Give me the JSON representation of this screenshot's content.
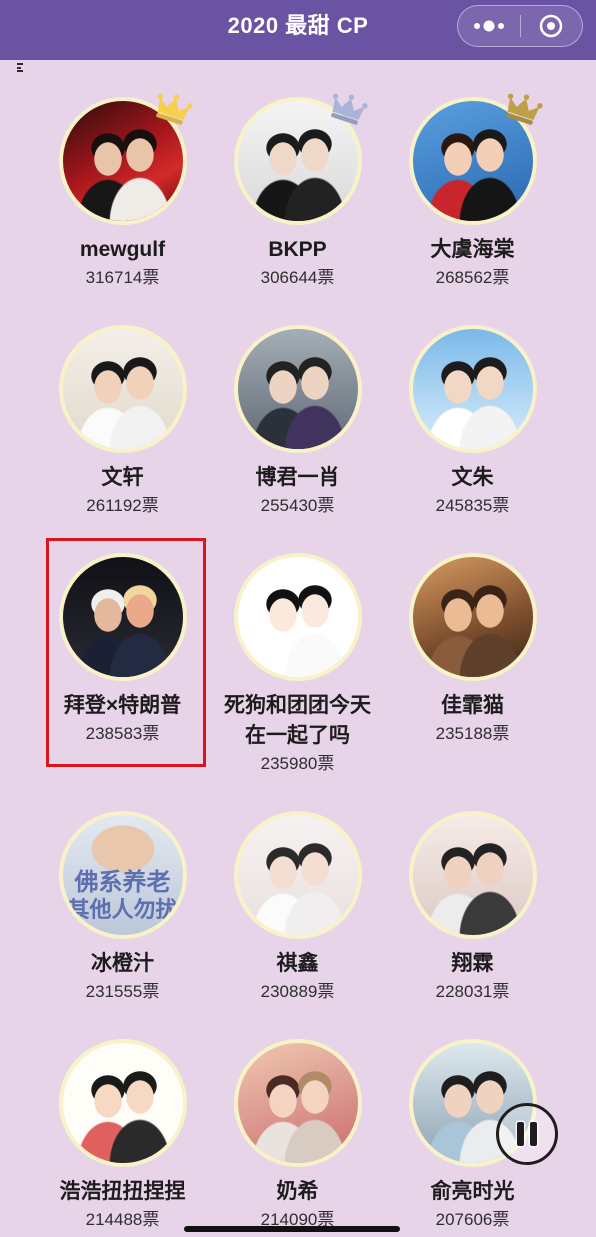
{
  "header": {
    "title": "2020 最甜 CP",
    "icons": {
      "more": "more-dots-icon",
      "exit": "target-circle-icon"
    }
  },
  "vote_unit": "票",
  "ranking": [
    {
      "name": "mewgulf",
      "votes": 316714,
      "crown": "gold-crown-icon"
    },
    {
      "name": "BKPP",
      "votes": 306644,
      "crown": "silver-crown-icon"
    },
    {
      "name": "大虞海棠",
      "votes": 268562,
      "crown": "bronze-crown-icon"
    },
    {
      "name": "文轩",
      "votes": 261192
    },
    {
      "name": "博君一肖",
      "votes": 255430
    },
    {
      "name": "文朱",
      "votes": 245835
    },
    {
      "name": "拜登×特朗普",
      "votes": 238583,
      "highlighted": true
    },
    {
      "name": "死狗和团团今天在一起了吗",
      "votes": 235980
    },
    {
      "name": "佳霏猫",
      "votes": 235188
    },
    {
      "name": "冰橙汁",
      "votes": 231555,
      "photo_caption": [
        "佛系养老",
        "其他人勿扰"
      ]
    },
    {
      "name": "祺鑫",
      "votes": 230889
    },
    {
      "name": "翔霖",
      "votes": 228031
    },
    {
      "name": "浩浩扭扭捏捏",
      "votes": 214488
    },
    {
      "name": "奶希",
      "votes": 214090
    },
    {
      "name": "俞亮时光",
      "votes": 207606
    }
  ],
  "crown_colors": {
    "gold-crown-icon": "#f6d04d",
    "silver-crown-icon": "#a9b4d8",
    "bronze-crown-icon": "#bfa04a"
  },
  "media_control": {
    "icon": "pause-icon"
  },
  "theme": {
    "header_bg": "#6a53a3",
    "page_bg": "#e8d4e9",
    "avatar_ring": "#f7f2c8",
    "highlight_border": "#d9141c"
  }
}
